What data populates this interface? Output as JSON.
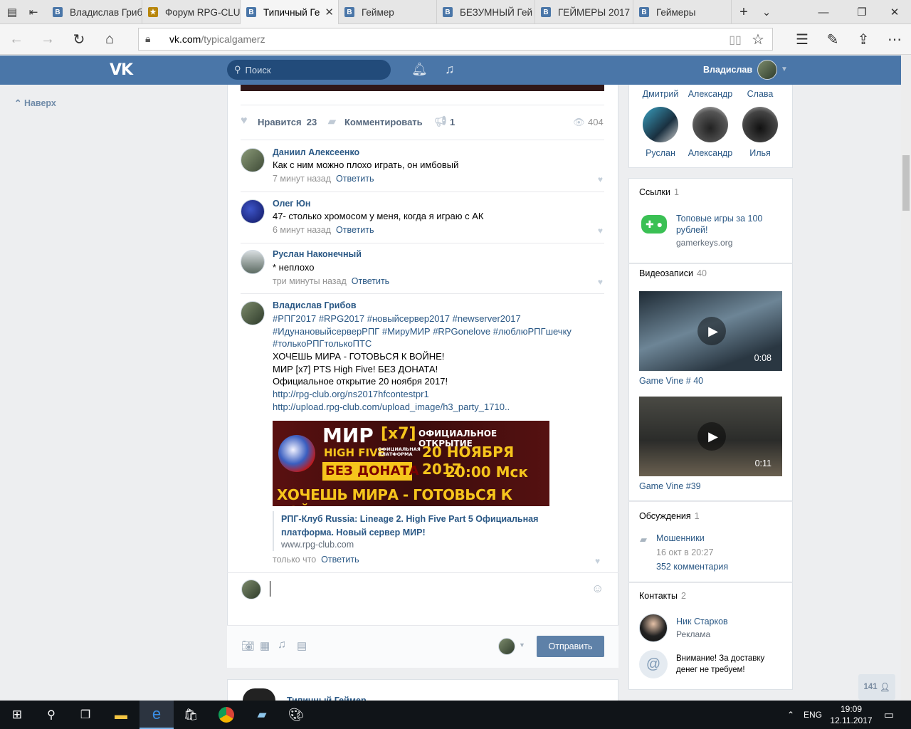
{
  "browser": {
    "tabs": [
      {
        "label": "Владислав Грибо",
        "icon": "vk-icon"
      },
      {
        "label": "Форум RPG-CLU",
        "icon": "rpg-club-icon"
      },
      {
        "label": "Типичный Ге",
        "icon": "vk-icon",
        "active": true
      },
      {
        "label": "Геймер",
        "icon": "vk-icon"
      },
      {
        "label": "БЕЗУМНЫЙ Гей",
        "icon": "vk-icon"
      },
      {
        "label": "ГЕЙМЕРЫ 2017",
        "icon": "vk-icon"
      },
      {
        "label": "Геймеры",
        "icon": "vk-icon"
      }
    ],
    "url_host": "vk.com",
    "url_path": "/typicalgamerz"
  },
  "vk_header": {
    "logo": "VK",
    "search_placeholder": "Поиск",
    "user_name": "Владислав"
  },
  "left": {
    "back_to_top": "Наверх"
  },
  "post": {
    "likes_label": "Нравится",
    "likes_count": "23",
    "comment_label": "Комментировать",
    "shares": "1",
    "views": "404"
  },
  "comments": [
    {
      "author": "Даниил Алексеенко",
      "text": "Как с ним можно плохо играть, он имбовый",
      "time": "7 минут назад",
      "reply": "Ответить"
    },
    {
      "author": "Олег Юн",
      "text": "47- столько хромосом у меня, когда я играю с АК",
      "time": "6 минут назад",
      "reply": "Ответить"
    },
    {
      "author": "Руслан Наконечный",
      "text": "* неплохо",
      "time": "три минуты назад",
      "reply": "Ответить"
    },
    {
      "author": "Владислав Грибов",
      "tags_line1": "#РПГ2017 #RPG2017 #новыйсервер2017 #newserver2017",
      "tags_line2": "#ИдунановыйсерверРПГ #МируМИР #RPGonelove #люблюРПГшечку",
      "tags_line3": "#толькоРПГтолькоПТС",
      "line1": "ХОЧЕШЬ МИРА - ГОТОВЬСЯ К ВОЙНЕ!",
      "line2": "МИР [x7] PTS High Five! БЕЗ ДОНАТА!",
      "line3": "Официальное открытие 20 ноября 2017!",
      "url1": "http://rpg-club.org/ns2017hfcontestpr1",
      "url2": "http://upload.rpg-club.com/upload_image/h3_party_1710..",
      "banner": {
        "mir": "МИР",
        "x7": "[x7]",
        "highfive": "HIGH FIVE",
        "platform": "ОФИЦИАЛЬНАЯ ПЛАТФОРМА",
        "opening": "ОФИЦИАЛЬНОЕ ОТКРЫТИЕ",
        "date": "20 НОЯБРЯ 2017",
        "time": "20:00 Мск",
        "nodonate": "БЕЗ ДОНАТА",
        "slogan": "ХОЧЕШЬ МИРА - ГОТОВЬСЯ К ВОЙНЕ"
      },
      "link_title": "РПГ-Клуб Russia: Lineage 2. High Five Part 5 Официальная платформа. Новый сервер МИР!",
      "link_domain": "www.rpg-club.com",
      "time": "только что",
      "reply": "Ответить"
    }
  ],
  "reply_box": {
    "send_label": "Отправить"
  },
  "next_post": {
    "author": "Типичный Геймер"
  },
  "right": {
    "friends_row1": [
      "Дмитрий",
      "Александр",
      "Слава"
    ],
    "friends_row2": [
      "Руслан",
      "Александр",
      "Илья"
    ],
    "links": {
      "title": "Ссылки",
      "count": "1",
      "item_title": "Топовые игры за 100 рублей!",
      "item_domain": "gamerkeys.org"
    },
    "videos": {
      "title": "Видеозаписи",
      "count": "40",
      "items": [
        {
          "title": "Game Vine # 40",
          "duration": "0:08"
        },
        {
          "title": "Game Vine #39",
          "duration": "0:11"
        }
      ]
    },
    "discussions": {
      "title": "Обсуждения",
      "count": "1",
      "topic": "Мошенники",
      "date": "16 окт в 20:27",
      "comments": "352 комментария"
    },
    "contacts": {
      "title": "Контакты",
      "count": "2",
      "items": [
        {
          "name": "Ник Старков",
          "role": "Реклама"
        },
        {
          "note": "Внимание! За доставку денег не требуем!"
        }
      ]
    },
    "online_count": "141"
  },
  "taskbar": {
    "lang": "ENG",
    "time": "19:09",
    "date": "12.11.2017"
  },
  "colors": {
    "vk_blue": "#4a76a8",
    "link": "#2a5885",
    "bg": "#edeef0"
  }
}
